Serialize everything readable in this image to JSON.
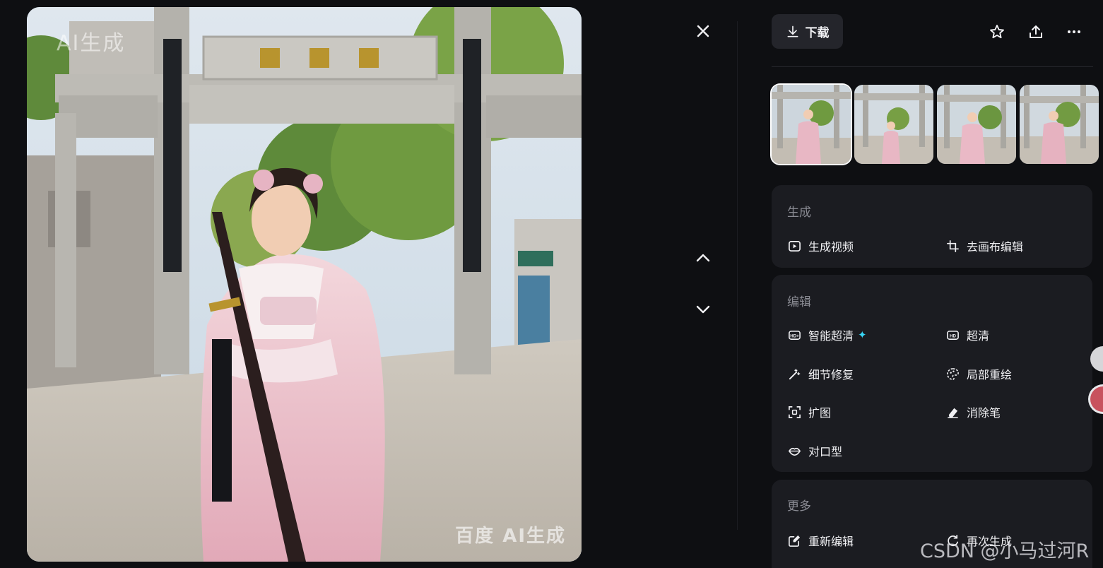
{
  "viewer": {
    "image_watermark_top": "AI生成",
    "image_watermark_bottom": "百度 AI生成",
    "close_icon": "close-icon",
    "prev_icon": "chevron-up-icon",
    "next_icon": "chevron-down-icon"
  },
  "toolbar": {
    "download_label": "下载",
    "download_icon": "download-icon",
    "favorite_icon": "star-icon",
    "share_icon": "share-icon",
    "more_icon": "more-icon"
  },
  "thumbnails": {
    "count": 4,
    "selected_index": 0
  },
  "sections": {
    "generate": {
      "title": "生成",
      "items": [
        {
          "label": "生成视频",
          "icon": "play-video-icon"
        },
        {
          "label": "去画布编辑",
          "icon": "crop-canvas-icon"
        }
      ]
    },
    "edit": {
      "title": "编辑",
      "items": [
        {
          "label": "智能超清",
          "icon": "hd-plus-icon",
          "badge": "✦"
        },
        {
          "label": "超清",
          "icon": "hd-icon"
        },
        {
          "label": "细节修复",
          "icon": "magic-wand-icon"
        },
        {
          "label": "局部重绘",
          "icon": "palette-icon"
        },
        {
          "label": "扩图",
          "icon": "expand-icon"
        },
        {
          "label": "消除笔",
          "icon": "eraser-icon"
        },
        {
          "label": "对口型",
          "icon": "lips-icon"
        }
      ]
    },
    "more": {
      "title": "更多",
      "items": [
        {
          "label": "重新编辑",
          "icon": "edit-icon"
        },
        {
          "label": "再次生成",
          "icon": "regenerate-icon"
        }
      ]
    }
  },
  "page_watermark": "CSDN @小马过河R",
  "colors": {
    "background": "#0e0f12",
    "card": "#1b1c21",
    "button": "#24252b",
    "sparkle": "#38d6f5"
  }
}
